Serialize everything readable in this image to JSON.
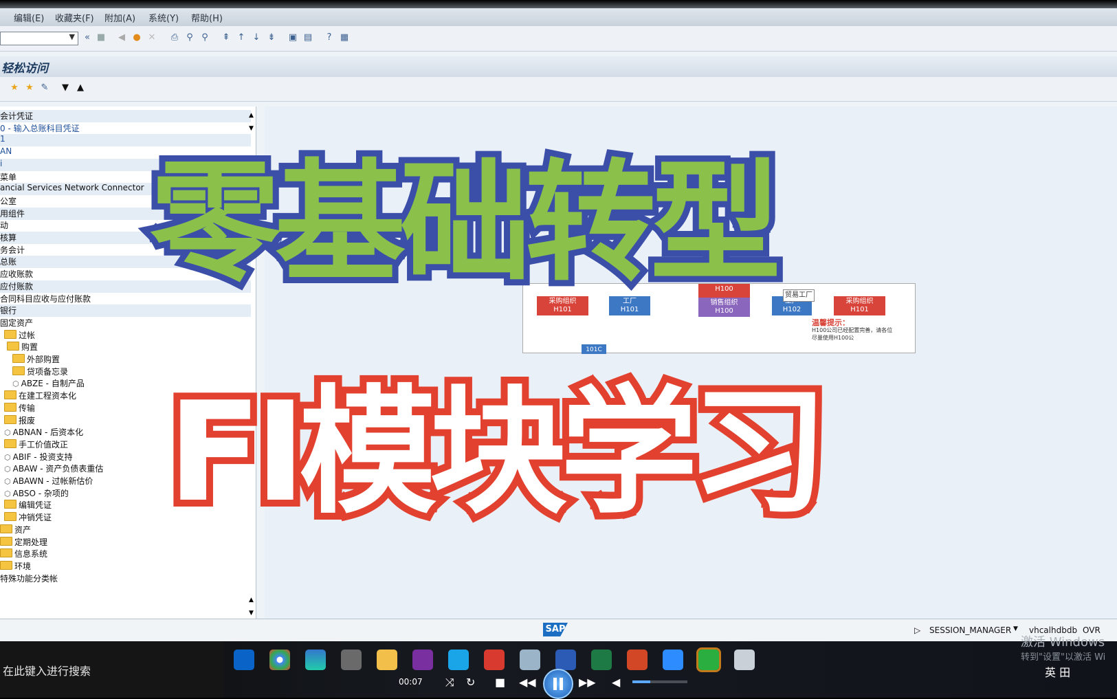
{
  "menu": [
    "编辑(E)",
    "收藏夹(F)",
    "附加(A)",
    "系统(Y)",
    "帮助(H)"
  ],
  "title": "轻松访问",
  "tree": [
    {
      "label": "会计凭证",
      "kind": "text",
      "blue": false
    },
    {
      "label": "0 - 输入总账科目凭证",
      "kind": "text",
      "blue": true
    },
    {
      "label": "1",
      "kind": "text",
      "blue": true
    },
    {
      "label": "AN",
      "kind": "text",
      "blue": true
    },
    {
      "label": "i",
      "kind": "text",
      "blue": true
    },
    {
      "label": "菜单",
      "kind": "text",
      "blue": false
    },
    {
      "label": "ancial Services Network Connector",
      "kind": "text",
      "blue": false
    },
    {
      "label": "公室",
      "kind": "text",
      "blue": false
    },
    {
      "label": "用组件",
      "kind": "text",
      "blue": false
    },
    {
      "label": "动",
      "kind": "text",
      "blue": false
    },
    {
      "label": "核算",
      "kind": "text",
      "blue": false
    },
    {
      "label": "务会计",
      "kind": "text",
      "blue": false
    },
    {
      "label": "总账",
      "kind": "text",
      "blue": false
    },
    {
      "label": "应收账款",
      "kind": "text",
      "blue": false
    },
    {
      "label": "应付账款",
      "kind": "text",
      "blue": false
    },
    {
      "label": "合同科目应收与应付账款",
      "kind": "text",
      "blue": false
    },
    {
      "label": "银行",
      "kind": "text",
      "blue": false
    },
    {
      "label": "固定资产",
      "kind": "text",
      "blue": false
    },
    {
      "label": "过帐",
      "kind": "folder",
      "blue": false
    },
    {
      "label": "购置",
      "kind": "folder",
      "blue": false
    },
    {
      "label": "外部购置",
      "kind": "folder",
      "blue": false
    },
    {
      "label": "贷项备忘录",
      "kind": "folder",
      "blue": false
    },
    {
      "label": "ABZE - 自制产品",
      "kind": "node",
      "blue": false
    },
    {
      "label": "在建工程资本化",
      "kind": "folder",
      "blue": false
    },
    {
      "label": "传输",
      "kind": "folder",
      "blue": false
    },
    {
      "label": "报废",
      "kind": "folder",
      "blue": false
    },
    {
      "label": "ABNAN - 后资本化",
      "kind": "node",
      "blue": false
    },
    {
      "label": "手工价值改正",
      "kind": "folder",
      "blue": false
    },
    {
      "label": "ABIF - 投资支持",
      "kind": "node",
      "blue": false
    },
    {
      "label": "ABAW - 资产负债表重估",
      "kind": "node",
      "blue": false
    },
    {
      "label": "ABAWN - 过帐新估价",
      "kind": "node",
      "blue": false
    },
    {
      "label": "ABSO - 杂项的",
      "kind": "node",
      "blue": false
    },
    {
      "label": "编辑凭证",
      "kind": "folder",
      "blue": false
    },
    {
      "label": "冲销凭证",
      "kind": "folder",
      "blue": false
    },
    {
      "label": "资产",
      "kind": "folder",
      "blue": false
    },
    {
      "label": "定期处理",
      "kind": "folder",
      "blue": false
    },
    {
      "label": "信息系统",
      "kind": "folder",
      "blue": false
    },
    {
      "label": "环境",
      "kind": "folder",
      "blue": false
    },
    {
      "label": "特殊功能分类帐",
      "kind": "text",
      "blue": false
    }
  ],
  "diagram": {
    "boxes": [
      "采购组织\nH101",
      "工厂\nH101",
      "H100",
      "销售组织\nH100",
      "工厂\nH102",
      "贸易工厂",
      "采购组织\nH101"
    ],
    "tip_title": "温馨提示：",
    "tip_text": "H100公司已经配置完善，请各位尽量使用H100公",
    "bottom_labels": [
      "101C"
    ]
  },
  "overlay": {
    "line1": "零基础转型",
    "line2": "FI模块学习"
  },
  "status": {
    "logo": "SAP",
    "session": "SESSION_MANAGER",
    "server": "vhcalhdbdb",
    "mode": "OVR"
  },
  "taskbar": {
    "search_placeholder": "在此键入进行搜索",
    "time": "00:07"
  },
  "watermark": {
    "line1": "激活 Windows",
    "line2": "转到\"设置\"以激活 Wi"
  },
  "tray": {
    "ime": "英 田"
  },
  "colors": {
    "overlay1_fill": "#8bc14a",
    "overlay1_stroke": "#3b4ea8",
    "overlay2_fill": "#ffffff",
    "overlay2_stroke": "#e2412f"
  }
}
